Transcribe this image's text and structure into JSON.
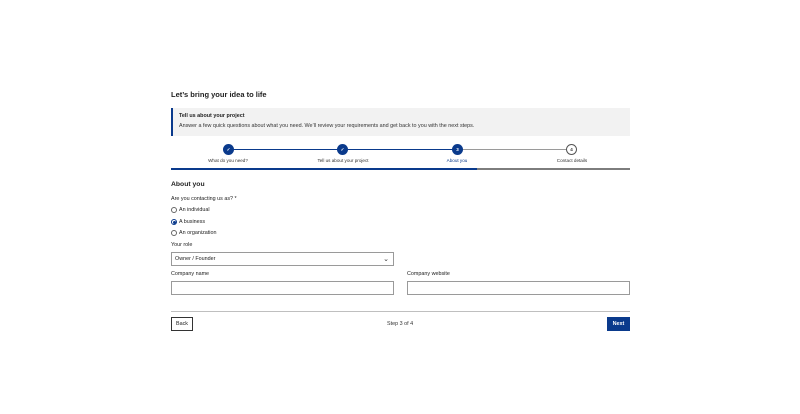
{
  "page": {
    "title": "Let’s bring your idea to life"
  },
  "info": {
    "title": "Tell us about your project",
    "description": "Answer a few quick questions about what you need. We’ll review your requirements and get back to you with the next steps."
  },
  "stepper": {
    "steps": [
      {
        "label": "What do you need?",
        "state": "done",
        "marker": "✓"
      },
      {
        "label": "Tell us about your project",
        "state": "done",
        "marker": "✓"
      },
      {
        "label": "About you",
        "state": "current",
        "marker": "3"
      },
      {
        "label": "Contact details",
        "state": "todo",
        "marker": "4"
      }
    ],
    "progress_fraction": 0.667
  },
  "section": {
    "title": "About you"
  },
  "contact_type": {
    "question": "Are you contacting us as? *",
    "options": [
      {
        "label": "An individual",
        "selected": false
      },
      {
        "label": "A business",
        "selected": true
      },
      {
        "label": "An organization",
        "selected": false
      }
    ]
  },
  "role": {
    "label": "Your role",
    "value": "Owner / Founder"
  },
  "company_name": {
    "label": "Company name",
    "value": ""
  },
  "company_website": {
    "label": "Company website",
    "value": ""
  },
  "footer": {
    "back_label": "Back",
    "step_text": "Step 3 of 4",
    "next_label": "Next"
  },
  "icons": {
    "chevron": "chevron-down-icon",
    "check": "check-icon"
  },
  "colors": {
    "accent": "#0a3a8c",
    "info_bg": "#f2f2f2"
  }
}
